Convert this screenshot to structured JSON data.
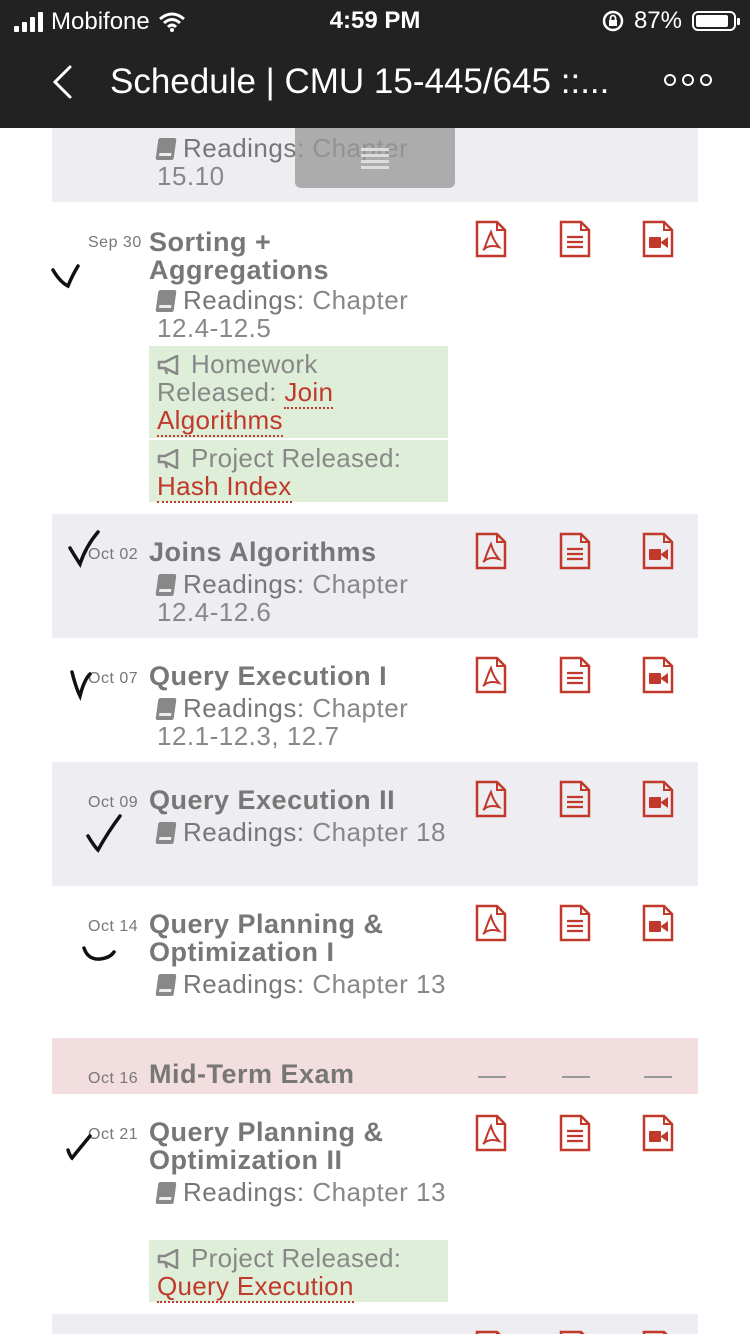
{
  "status_bar": {
    "carrier": "Mobifone",
    "time": "4:59 PM",
    "battery": "87%"
  },
  "nav": {
    "title": "Schedule | CMU 15-445/645 ::..."
  },
  "readings_label": "Readings:",
  "rows": [
    {
      "reading": "Chapter 15.10"
    },
    {
      "date": "Sep 30",
      "title": "Sorting + Aggregations",
      "reading": "Chapter 12.4-12.5",
      "note1_text": "Homework Released:",
      "note1_link": "Join Algorithms",
      "note2_text": "Project Released:",
      "note2_link": "Hash Index"
    },
    {
      "date": "Oct 02",
      "title": "Joins Algorithms",
      "reading": "Chapter 12.4-12.6"
    },
    {
      "date": "Oct 07",
      "title": "Query Execution I",
      "reading": "Chapter 12.1-12.3, 12.7"
    },
    {
      "date": "Oct 09",
      "title": "Query Execution II",
      "reading": "Chapter 18"
    },
    {
      "date": "Oct 14",
      "title": "Query Planning & Optimization I",
      "reading": "Chapter 13"
    },
    {
      "date": "Oct 16",
      "title": "Mid-Term Exam"
    },
    {
      "date": "Oct 21",
      "title": "Query Planning & Optimization II",
      "reading": "Chapter 13",
      "note1_text": "Project Released:",
      "note1_link": "Query Execution"
    }
  ],
  "colors": {
    "accent": "#c0392b",
    "note_bg": "#dfeed8",
    "row_gray": "#ededf2",
    "row_exam": "#f2dede"
  },
  "icons": [
    "pdf-icon",
    "notes-icon",
    "video-icon"
  ]
}
